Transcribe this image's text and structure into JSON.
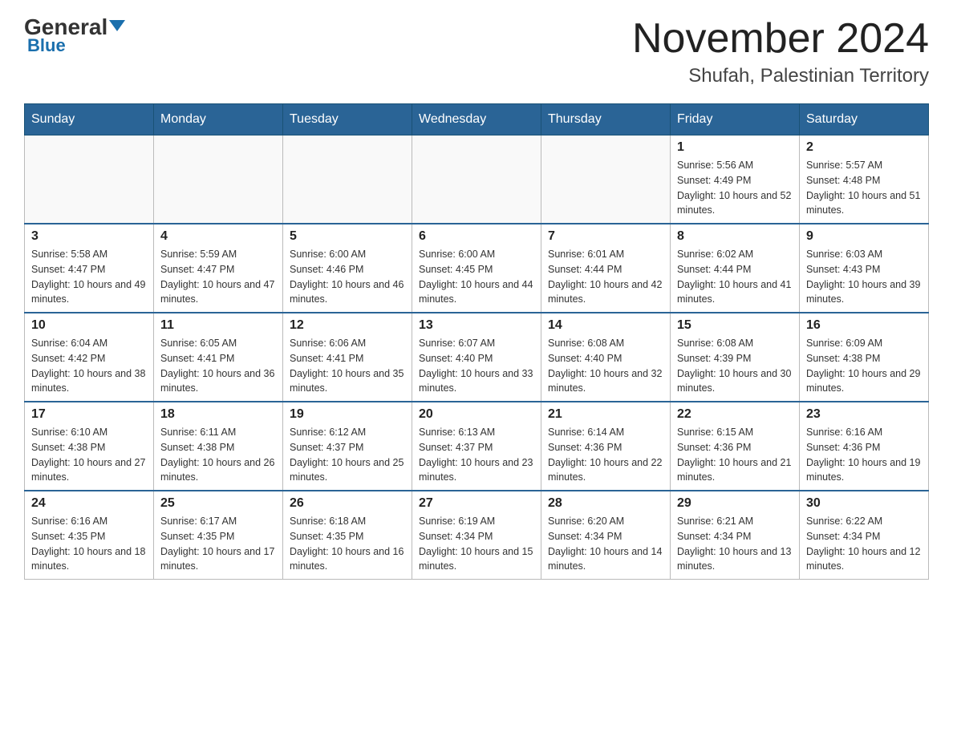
{
  "header": {
    "logo_general": "General",
    "logo_blue": "Blue",
    "title": "November 2024",
    "subtitle": "Shufah, Palestinian Territory"
  },
  "days_of_week": [
    "Sunday",
    "Monday",
    "Tuesday",
    "Wednesday",
    "Thursday",
    "Friday",
    "Saturday"
  ],
  "weeks": [
    [
      {
        "day": "",
        "info": ""
      },
      {
        "day": "",
        "info": ""
      },
      {
        "day": "",
        "info": ""
      },
      {
        "day": "",
        "info": ""
      },
      {
        "day": "",
        "info": ""
      },
      {
        "day": "1",
        "info": "Sunrise: 5:56 AM\nSunset: 4:49 PM\nDaylight: 10 hours and 52 minutes."
      },
      {
        "day": "2",
        "info": "Sunrise: 5:57 AM\nSunset: 4:48 PM\nDaylight: 10 hours and 51 minutes."
      }
    ],
    [
      {
        "day": "3",
        "info": "Sunrise: 5:58 AM\nSunset: 4:47 PM\nDaylight: 10 hours and 49 minutes."
      },
      {
        "day": "4",
        "info": "Sunrise: 5:59 AM\nSunset: 4:47 PM\nDaylight: 10 hours and 47 minutes."
      },
      {
        "day": "5",
        "info": "Sunrise: 6:00 AM\nSunset: 4:46 PM\nDaylight: 10 hours and 46 minutes."
      },
      {
        "day": "6",
        "info": "Sunrise: 6:00 AM\nSunset: 4:45 PM\nDaylight: 10 hours and 44 minutes."
      },
      {
        "day": "7",
        "info": "Sunrise: 6:01 AM\nSunset: 4:44 PM\nDaylight: 10 hours and 42 minutes."
      },
      {
        "day": "8",
        "info": "Sunrise: 6:02 AM\nSunset: 4:44 PM\nDaylight: 10 hours and 41 minutes."
      },
      {
        "day": "9",
        "info": "Sunrise: 6:03 AM\nSunset: 4:43 PM\nDaylight: 10 hours and 39 minutes."
      }
    ],
    [
      {
        "day": "10",
        "info": "Sunrise: 6:04 AM\nSunset: 4:42 PM\nDaylight: 10 hours and 38 minutes."
      },
      {
        "day": "11",
        "info": "Sunrise: 6:05 AM\nSunset: 4:41 PM\nDaylight: 10 hours and 36 minutes."
      },
      {
        "day": "12",
        "info": "Sunrise: 6:06 AM\nSunset: 4:41 PM\nDaylight: 10 hours and 35 minutes."
      },
      {
        "day": "13",
        "info": "Sunrise: 6:07 AM\nSunset: 4:40 PM\nDaylight: 10 hours and 33 minutes."
      },
      {
        "day": "14",
        "info": "Sunrise: 6:08 AM\nSunset: 4:40 PM\nDaylight: 10 hours and 32 minutes."
      },
      {
        "day": "15",
        "info": "Sunrise: 6:08 AM\nSunset: 4:39 PM\nDaylight: 10 hours and 30 minutes."
      },
      {
        "day": "16",
        "info": "Sunrise: 6:09 AM\nSunset: 4:38 PM\nDaylight: 10 hours and 29 minutes."
      }
    ],
    [
      {
        "day": "17",
        "info": "Sunrise: 6:10 AM\nSunset: 4:38 PM\nDaylight: 10 hours and 27 minutes."
      },
      {
        "day": "18",
        "info": "Sunrise: 6:11 AM\nSunset: 4:38 PM\nDaylight: 10 hours and 26 minutes."
      },
      {
        "day": "19",
        "info": "Sunrise: 6:12 AM\nSunset: 4:37 PM\nDaylight: 10 hours and 25 minutes."
      },
      {
        "day": "20",
        "info": "Sunrise: 6:13 AM\nSunset: 4:37 PM\nDaylight: 10 hours and 23 minutes."
      },
      {
        "day": "21",
        "info": "Sunrise: 6:14 AM\nSunset: 4:36 PM\nDaylight: 10 hours and 22 minutes."
      },
      {
        "day": "22",
        "info": "Sunrise: 6:15 AM\nSunset: 4:36 PM\nDaylight: 10 hours and 21 minutes."
      },
      {
        "day": "23",
        "info": "Sunrise: 6:16 AM\nSunset: 4:36 PM\nDaylight: 10 hours and 19 minutes."
      }
    ],
    [
      {
        "day": "24",
        "info": "Sunrise: 6:16 AM\nSunset: 4:35 PM\nDaylight: 10 hours and 18 minutes."
      },
      {
        "day": "25",
        "info": "Sunrise: 6:17 AM\nSunset: 4:35 PM\nDaylight: 10 hours and 17 minutes."
      },
      {
        "day": "26",
        "info": "Sunrise: 6:18 AM\nSunset: 4:35 PM\nDaylight: 10 hours and 16 minutes."
      },
      {
        "day": "27",
        "info": "Sunrise: 6:19 AM\nSunset: 4:34 PM\nDaylight: 10 hours and 15 minutes."
      },
      {
        "day": "28",
        "info": "Sunrise: 6:20 AM\nSunset: 4:34 PM\nDaylight: 10 hours and 14 minutes."
      },
      {
        "day": "29",
        "info": "Sunrise: 6:21 AM\nSunset: 4:34 PM\nDaylight: 10 hours and 13 minutes."
      },
      {
        "day": "30",
        "info": "Sunrise: 6:22 AM\nSunset: 4:34 PM\nDaylight: 10 hours and 12 minutes."
      }
    ]
  ]
}
